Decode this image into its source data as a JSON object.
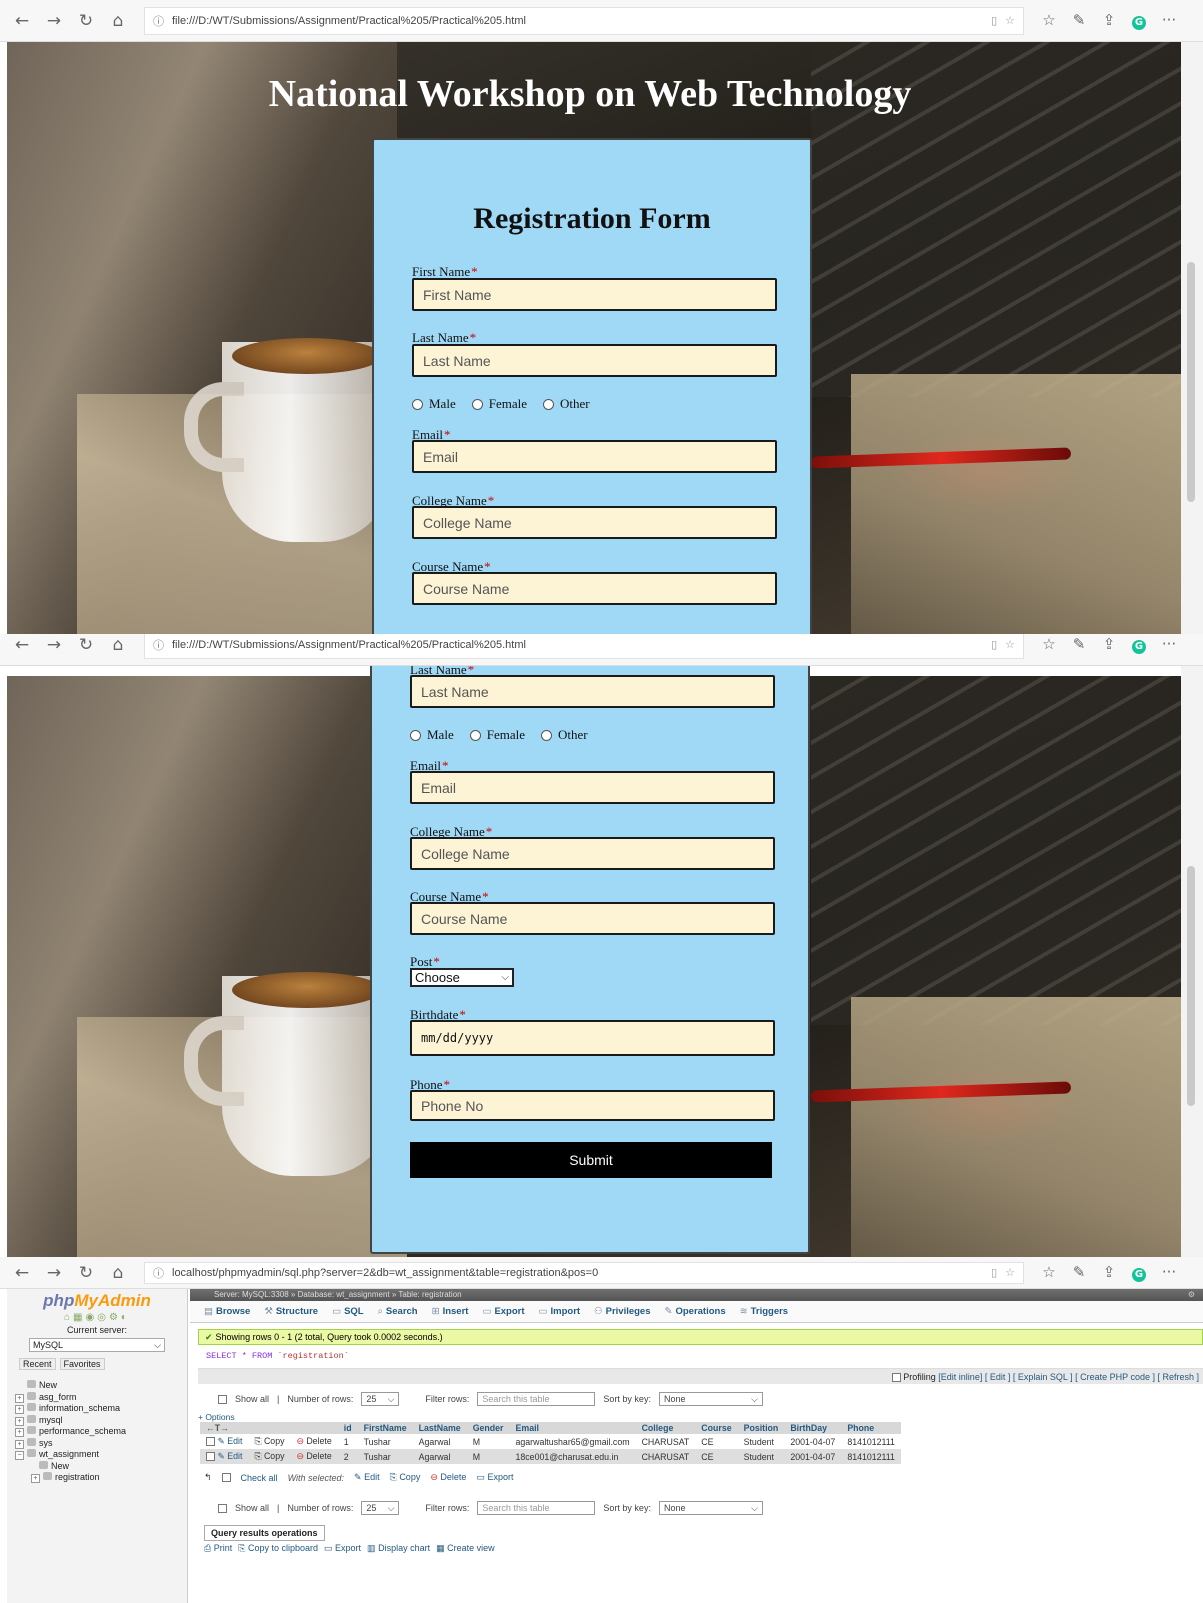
{
  "browser": {
    "nav_back": "←",
    "nav_forward": "→",
    "nav_refresh": "↻",
    "nav_home": "⌂",
    "url_local": "file:///D:/WT/Submissions/Assignment/Practical%205/Practical%205.html",
    "url_pma": "localhost/phpmyadmin/sql.php?server=2&db=wt_assignment&table=registration&pos=0",
    "more": "···"
  },
  "page": {
    "title": "National Workshop on Web Technology",
    "form_title": "Registration Form",
    "required_mark": "*"
  },
  "form": {
    "first_name_label": "First Name",
    "first_name_placeholder": "First Name",
    "last_name_label": "Last Name",
    "last_name_placeholder": "Last Name",
    "gender_options": [
      "Male",
      "Female",
      "Other"
    ],
    "email_label": "Email",
    "email_placeholder": "Email",
    "college_label": "College Name",
    "college_placeholder": "College Name",
    "course_label": "Course Name",
    "course_placeholder": "Course Name",
    "post_label": "Post",
    "post_selected": "Choose",
    "birthdate_label": "Birthdate",
    "birthdate_placeholder": "mm/dd/yyyy",
    "phone_label": "Phone",
    "phone_placeholder": "Phone No",
    "submit_label": "Submit"
  },
  "pma": {
    "logo_php": "php",
    "logo_my": "MyAdmin",
    "current_server_label": "Current server:",
    "server_value": "MySQL",
    "tab_recent": "Recent",
    "tab_favorites": "Favorites",
    "tree": [
      "New",
      "asg_form",
      "information_schema",
      "mysql",
      "performance_schema",
      "sys",
      "wt_assignment",
      "New",
      "registration"
    ],
    "breadcrumb": "Server: MySQL:3308 » Database: wt_assignment » Table: registration",
    "nav": [
      "Browse",
      "Structure",
      "SQL",
      "Search",
      "Insert",
      "Export",
      "Import",
      "Privileges",
      "Operations",
      "Triggers"
    ],
    "success_msg": "Showing rows 0 - 1 (2 total, Query took 0.0002 seconds.)",
    "sql_kw": "SELECT * FROM",
    "sql_table": "`registration`",
    "sql_links": [
      "Profiling",
      "[Edit inline]",
      "[ Edit ]",
      "[ Explain SQL ]",
      "[ Create PHP code ]",
      "[ Refresh ]"
    ],
    "show_all": "Show all",
    "rows_label": "Number of rows:",
    "rows_value": "25",
    "filter_label": "Filter rows:",
    "filter_placeholder": "Search this table",
    "sort_label": "Sort by key:",
    "sort_value": "None",
    "options_link": "+ Options",
    "columns": [
      "id",
      "FirstName",
      "LastName",
      "Gender",
      "Email",
      "College",
      "Course",
      "Position",
      "BirthDay",
      "Phone"
    ],
    "rows": [
      [
        "1",
        "Tushar",
        "Agarwal",
        "M",
        "agarwaltushar65@gmail.com",
        "CHARUSAT",
        "CE",
        "Student",
        "2001-04-07",
        "8141012111"
      ],
      [
        "2",
        "Tushar",
        "Agarwal",
        "M",
        "18ce001@charusat.edu.in",
        "CHARUSAT",
        "CE",
        "Student",
        "2001-04-07",
        "8141012111"
      ]
    ],
    "row_actions": [
      "Edit",
      "Copy",
      "Delete"
    ],
    "check_all": "Check all",
    "with_selected": "With selected:",
    "bulk_actions": [
      "Edit",
      "Copy",
      "Delete",
      "Export"
    ],
    "qro_title": "Query results operations",
    "qro_links": [
      "Print",
      "Copy to clipboard",
      "Export",
      "Display chart",
      "Create view"
    ]
  }
}
